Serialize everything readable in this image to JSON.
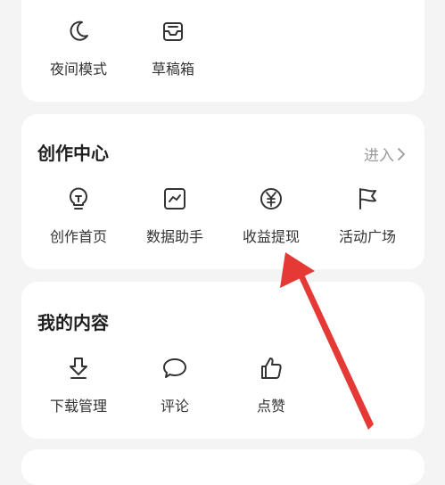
{
  "section_top": {
    "items": [
      {
        "label": "夜间模式",
        "icon": "moon-icon"
      },
      {
        "label": "草稿箱",
        "icon": "drafts-inbox-icon"
      }
    ]
  },
  "creation_center": {
    "title": "创作中心",
    "enter_label": "进入",
    "items": [
      {
        "label": "创作首页",
        "icon": "lightbulb-icon"
      },
      {
        "label": "数据助手",
        "icon": "chart-line-icon"
      },
      {
        "label": "收益提现",
        "icon": "yen-coin-icon"
      },
      {
        "label": "活动广场",
        "icon": "flag-icon"
      }
    ]
  },
  "my_content": {
    "title": "我的内容",
    "items": [
      {
        "label": "下载管理",
        "icon": "download-icon"
      },
      {
        "label": "评论",
        "icon": "comment-bubble-icon"
      },
      {
        "label": "点赞",
        "icon": "thumbs-up-icon"
      }
    ]
  },
  "annotation": {
    "arrow_color": "#e53935"
  }
}
